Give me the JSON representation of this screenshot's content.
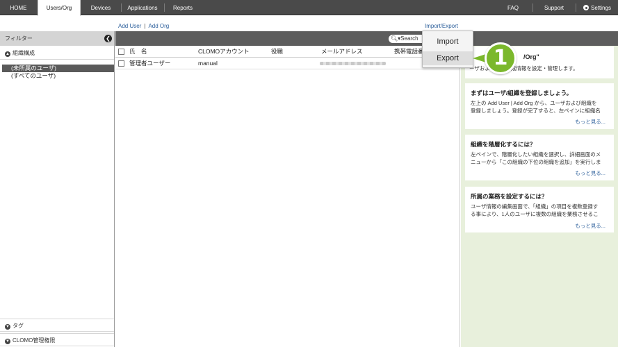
{
  "nav": {
    "items": [
      "HOME",
      "Users/Org",
      "Devices",
      "Applications",
      "Reports"
    ],
    "right": [
      "FAQ",
      "Support",
      "Settings"
    ]
  },
  "actions": {
    "add_user": "Add User",
    "separator": "|",
    "add_org": "Add Org",
    "import_export": "Import/Export"
  },
  "left": {
    "filter": "フィルター",
    "collapse_glyph": "❮",
    "org_section": "組織構成",
    "tree": [
      "(未所属のユーザ)",
      "(すべてのユーザ)"
    ],
    "tag_section": "タグ",
    "admin_section": "CLOMO管理権限"
  },
  "search": {
    "label": "Search"
  },
  "table": {
    "headers": [
      "氏　名",
      "CLOMOアカウント",
      "役職",
      "メールアドレス",
      "携帯電話番"
    ],
    "rows": [
      {
        "name": "管理者ユーザー",
        "account": "manual"
      }
    ]
  },
  "dropdown": {
    "items": [
      "Import",
      "Export"
    ]
  },
  "callout": {
    "number": "1"
  },
  "right": {
    "intro_title": "/Org\"",
    "intro_text": "ーザおよび組織構成情報を設定・管理します。",
    "cards": [
      {
        "title": "まずはユーザ/組織を登録しましょう。",
        "lines": [
          "左上の Add User | Add Org から、ユーザおよび組織を",
          "登録しましょう。登録が完了すると、左ペインに組織名"
        ],
        "more": "もっと見る..."
      },
      {
        "title": "組織を階層化するには？",
        "lines": [
          "左ペインで、階層化したい組織を選択し、詳細画面のメ",
          "ニューから「この組織の下位の組織を追加」を実行しま"
        ],
        "more": "もっと見る..."
      },
      {
        "title": "所属の業務を設定するには？",
        "lines": [
          "ユーザ情報の編集画面で、「組織」の項目を複数登録す",
          "る事により、1人のユーザに複数の組織を業務させるこ"
        ],
        "more": "もっと見る..."
      }
    ]
  },
  "colors": {
    "accent": "#7bb82c",
    "nav_bg": "#4a4a4a",
    "link": "#2c5f9b",
    "help_bg": "#e8f0dc"
  }
}
